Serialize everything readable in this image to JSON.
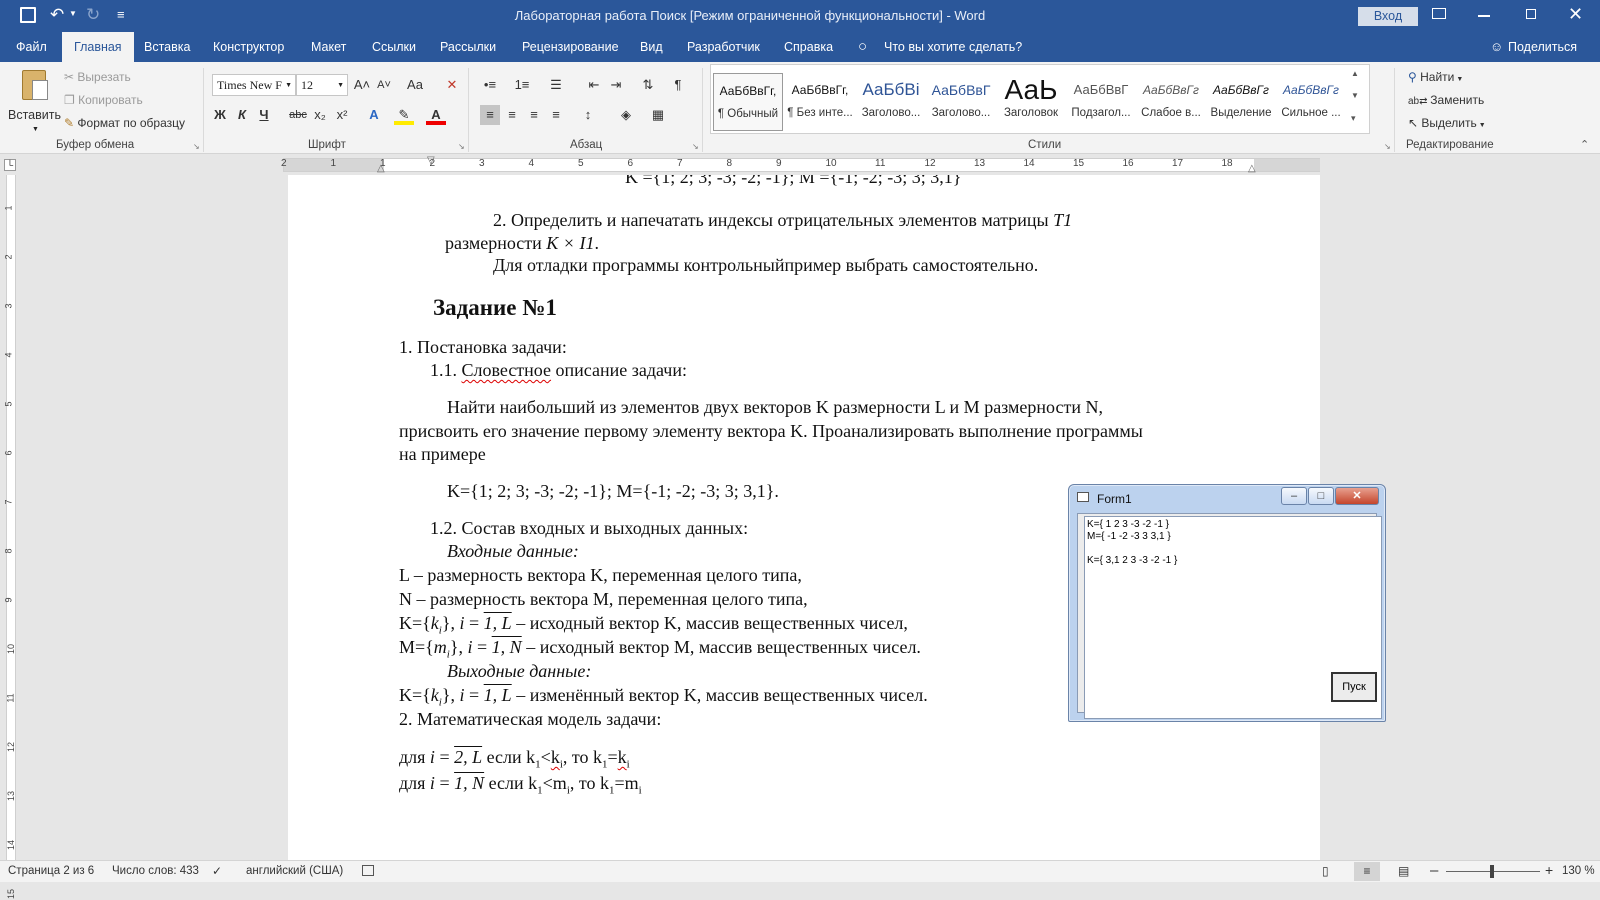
{
  "titlebar": {
    "title": "Лабораторная работа Поиск [Режим ограниченной функциональности]  -  Word",
    "signin": "Вход",
    "qat_more": "≡"
  },
  "tabs": [
    "Файл",
    "Главная",
    "Вставка",
    "Конструктор",
    "Макет",
    "Ссылки",
    "Рассылки",
    "Рецензирование",
    "Вид",
    "Разработчик",
    "Справка"
  ],
  "tell_me": "Что вы хотите сделать?",
  "share": "Поделиться",
  "ribbon": {
    "clipboard": {
      "paste": "Вставить",
      "cut": "Вырезать",
      "copy": "Копировать",
      "format_painter": "Формат по образцу",
      "label": "Буфер обмена"
    },
    "font": {
      "name": "Times New F",
      "size": "12",
      "label": "Шрифт",
      "bold": "Ж",
      "italic": "К",
      "underline": "Ч",
      "strike": "abc",
      "aa": "Aa"
    },
    "paragraph": {
      "label": "Абзац"
    },
    "styles": {
      "label": "Стили",
      "items": [
        {
          "sample": "АаБбВвГг,",
          "name": "¶ Обычный"
        },
        {
          "sample": "АаБбВвГг,",
          "name": "¶ Без инте..."
        },
        {
          "sample": "АаБбВі",
          "name": "Заголово..."
        },
        {
          "sample": "АаБбВвГ",
          "name": "Заголово..."
        },
        {
          "sample": "АаЬ",
          "name": "Заголовок"
        },
        {
          "sample": "АаБбВвГ",
          "name": "Подзагол..."
        },
        {
          "sample": "АаБбВвГг",
          "name": "Слабое в..."
        },
        {
          "sample": "АаБбВвГг",
          "name": "Выделение"
        },
        {
          "sample": "АаБбВвГг",
          "name": "Сильное ..."
        }
      ]
    },
    "editing": {
      "find": "Найти",
      "replace": "Заменить",
      "select": "Выделить",
      "label": "Редактирование"
    }
  },
  "ruler": {
    "h_ticks": [
      "2",
      "1",
      "1",
      "2",
      "3",
      "4",
      "5",
      "6",
      "7",
      "8",
      "9",
      "10",
      "11",
      "12",
      "13",
      "14",
      "15",
      "16",
      "17",
      "18"
    ],
    "v_ticks": [
      "1",
      "2",
      "3",
      "4",
      "5",
      "6",
      "7",
      "8",
      "9",
      "10",
      "11",
      "12",
      "13",
      "14",
      "15"
    ]
  },
  "doc": {
    "cut_line": "K ={1; 2; 3; -3; -2; -1};  M ={-1; -2; -3; 3; 3,1}",
    "task2_a": "2. Определить и напечатать индексы отрицательных элементов матрицы ",
    "task2_a_it": "T1",
    "task2_b": "размерности ",
    "task2_b_it": "K × I1",
    "task2_b_end": ".",
    "task2_c": "Для отладки программы контрольныйпример выбрать самостоятельно.",
    "heading": "Задание №1",
    "item1": "1.   Постановка задачи:",
    "item11_num": "1.1. ",
    "item11_word": "Словестное",
    "item11_rest": " описание задачи:",
    "para1": "Найти наибольший из элементов двух векторов K размерности L и M размерности N,",
    "para2": "присвоить его значение первому элементу вектора K. Проанализировать выполнение программы",
    "para3": "на примере",
    "example": "K={1; 2; 3; -3; -2; -1}; M={-1; -2; -3; 3; 3,1}.",
    "item12": "1.2. Состав входных и выходных данных:",
    "input_h": "Входные данные:",
    "in1": "L – размерность вектора K, переменная целого типа,",
    "in2": "N – размерность вектора M, переменная целого типа,",
    "in3_pre": "K={",
    "in3_var": "k",
    "in3_sub": "i",
    "in3_mid": "}, ",
    "in3_i": "i",
    "in3_eq": " = ",
    "in3_range": "1, L",
    "in3_rest": " – исходный вектор K, массив вещественных чисел,",
    "in4_pre": "M={",
    "in4_var": "m",
    "in4_sub": "i",
    "in4_mid": "}, ",
    "in4_i": "i",
    "in4_eq": " = ",
    "in4_range": "1, N",
    "in4_rest": " – исходный вектор M, массив вещественных чисел.",
    "output_h": "Выходные данные:",
    "out1_pre": "K={",
    "out1_var": "k",
    "out1_sub": "i",
    "out1_mid": "}, ",
    "out1_i": "i",
    "out1_eq": " = ",
    "out1_range": "1, L",
    "out1_rest": " – изменённый вектор K, массив вещественных чисел.",
    "item2": "2.   Математическая модель задачи:",
    "m1_pre": "для ",
    "m1_i": "i",
    "m1_eq": " = ",
    "m1_range": "2, L",
    "m1_a": " если k",
    "m1_s1": "1",
    "m1_b": "<",
    "m1_c": "k",
    "m1_s2": "i",
    "m1_d": ", то k",
    "m1_s3": "1",
    "m1_e": "=",
    "m1_f": "k",
    "m1_s4": "i",
    "m2_pre": "для ",
    "m2_i": "i",
    "m2_eq": " = ",
    "m2_range": "1, N",
    "m2_a": " если k",
    "m2_s1": "1",
    "m2_b": "<m",
    "m2_s2": "i",
    "m2_c": ", то k",
    "m2_s3": "1",
    "m2_d": "=m",
    "m2_s4": "i"
  },
  "form1": {
    "title": "Form1",
    "memo_lines": [
      "K={ 1 2 3 -3 -2 -1 }",
      "M={ -1 -2 -3 3 3,1 }",
      "",
      "K={ 3,1 2 3 -3 -2 -1 }"
    ],
    "button": "Пуск"
  },
  "status": {
    "page": "Страница 2 из 6",
    "words": "Число слов: 433",
    "lang": "английский (США)",
    "zoom": "130 %"
  }
}
